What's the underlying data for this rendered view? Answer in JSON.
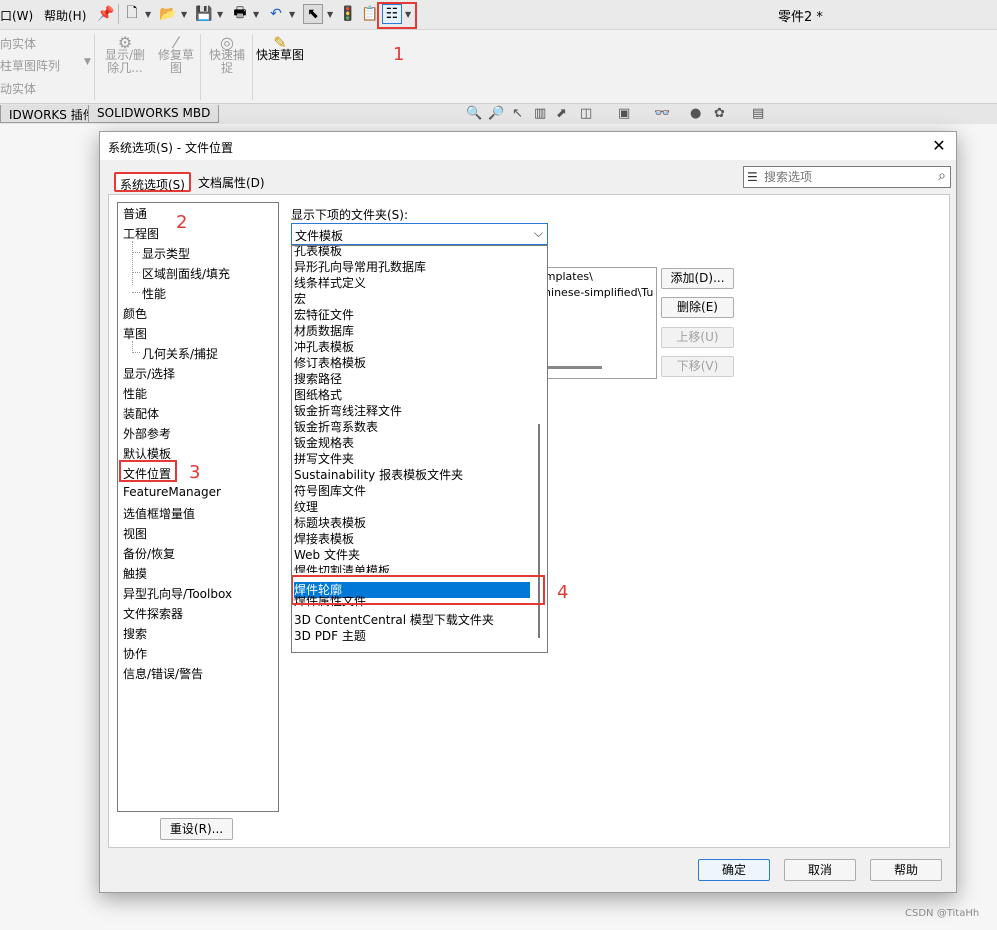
{
  "menubar": {
    "items": [
      "口(W)",
      "帮助(H)"
    ],
    "doc_title": "零件2 *"
  },
  "ribbon": {
    "left_items": [
      "向实体",
      "柱草图阵列",
      "动实体"
    ],
    "buttons": [
      {
        "label": "显示/删除几..."
      },
      {
        "label": "修复草图"
      },
      {
        "label": "快速捕捉"
      },
      {
        "label": "快速草图"
      }
    ]
  },
  "command_tabs": [
    "IDWORKS 插件",
    "SOLIDWORKS MBD"
  ],
  "dialog": {
    "title": "系统选项(S) - 文件位置",
    "tabs": {
      "system": "系统选项(S)",
      "doc": "文档属性(D)"
    },
    "search_placeholder": "搜索选项",
    "tree": [
      {
        "label": "普通",
        "level": 0
      },
      {
        "label": "工程图",
        "level": 0
      },
      {
        "label": "显示类型",
        "level": 1
      },
      {
        "label": "区域剖面线/填充",
        "level": 1
      },
      {
        "label": "性能",
        "level": 1
      },
      {
        "label": "颜色",
        "level": 0
      },
      {
        "label": "草图",
        "level": 0
      },
      {
        "label": "几何关系/捕捉",
        "level": 1
      },
      {
        "label": "显示/选择",
        "level": 0
      },
      {
        "label": "性能",
        "level": 0
      },
      {
        "label": "装配体",
        "level": 0
      },
      {
        "label": "外部参考",
        "level": 0
      },
      {
        "label": "默认模板",
        "level": 0
      },
      {
        "label": "文件位置",
        "level": 0
      },
      {
        "label": "FeatureManager",
        "level": 0
      },
      {
        "label": "选值框增量值",
        "level": 0
      },
      {
        "label": "视图",
        "level": 0
      },
      {
        "label": "备份/恢复",
        "level": 0
      },
      {
        "label": "触摸",
        "level": 0
      },
      {
        "label": "异型孔向导/Toolbox",
        "level": 0
      },
      {
        "label": "文件探索器",
        "level": 0
      },
      {
        "label": "搜索",
        "level": 0
      },
      {
        "label": "协作",
        "level": 0
      },
      {
        "label": "信息/错误/警告",
        "level": 0
      }
    ],
    "folder_label": "显示下项的文件夹(S):",
    "folder_value": "文件模板",
    "paths": [
      "emplates\\",
      "chinese-simplified\\Tu"
    ],
    "side_buttons": {
      "add": "添加(D)...",
      "delete": "删除(E)",
      "up": "上移(U)",
      "down": "下移(V)"
    },
    "dropdown_items": [
      "孔表模板",
      "异形孔向导常用孔数据库",
      "线条样式定义",
      "宏",
      "宏特征文件",
      "材质数据库",
      "冲孔表模板",
      "修订表格模板",
      "搜索路径",
      "图纸格式",
      "钣金折弯线注释文件",
      "钣金折弯系数表",
      "钣金规格表",
      "拼写文件夹",
      "Sustainability 报表模板文件夹",
      "符号图库文件",
      "纹理",
      "标题块表模板",
      "焊接表模板",
      "Web 文件夹",
      "焊件切割清单模板",
      "焊件轮廓",
      "焊件属性文件",
      "3D ContentCentral 模型下载文件夹",
      "3D PDF 主题"
    ],
    "selected_item": "焊件轮廓",
    "reset": "重设(R)...",
    "footer": {
      "ok": "确定",
      "cancel": "取消",
      "help": "帮助"
    }
  },
  "annotations": [
    "1",
    "2",
    "3",
    "4"
  ],
  "accent_color": "#e53935",
  "selection_color": "#0078d7",
  "watermark": "CSDN @TitaHh"
}
